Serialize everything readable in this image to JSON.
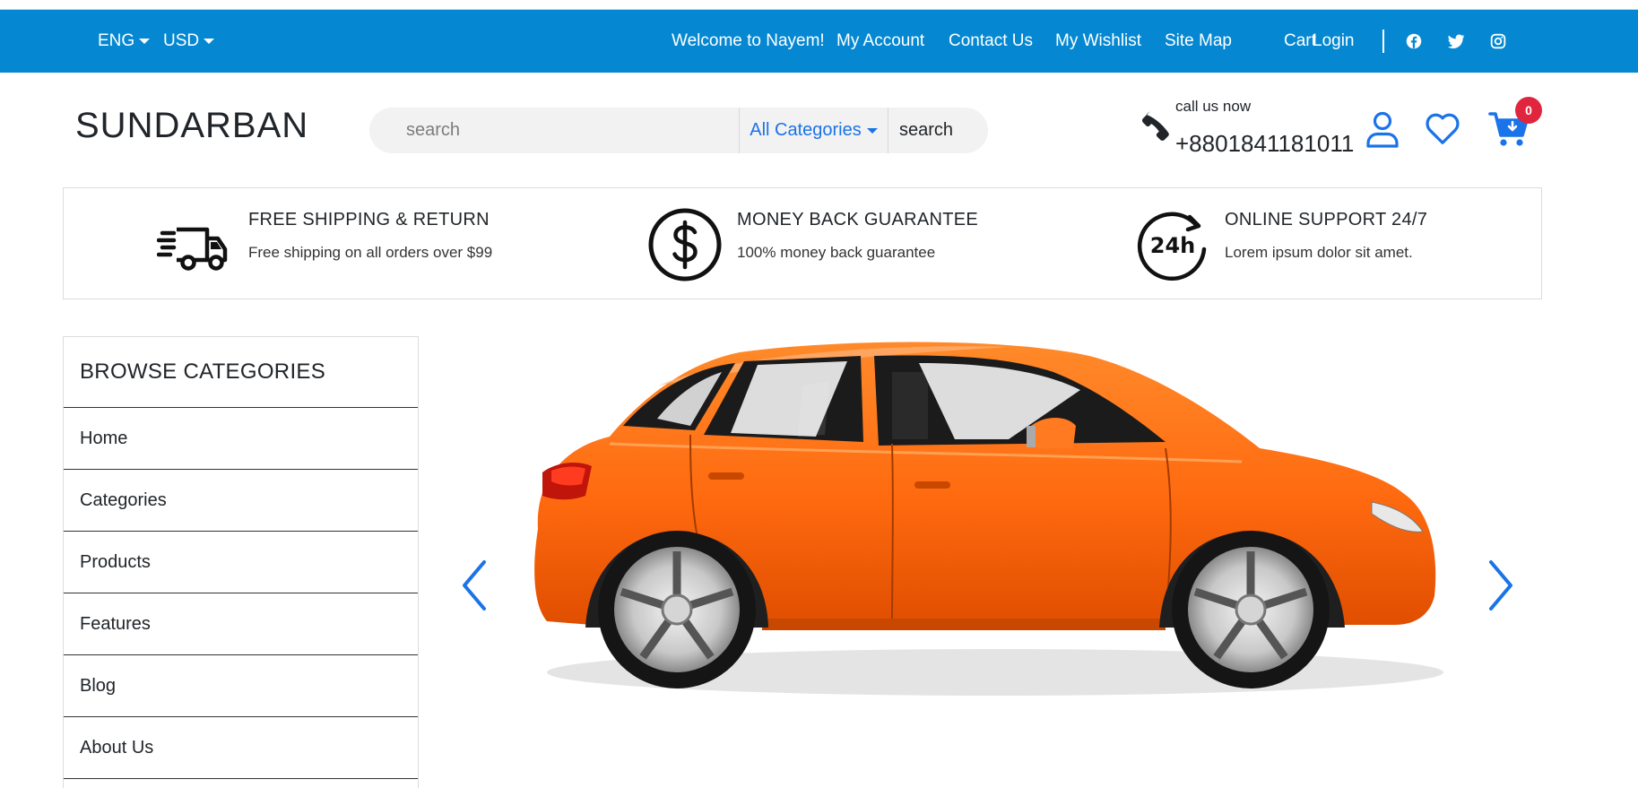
{
  "topbar": {
    "language": "ENG",
    "currency": "USD",
    "welcome": "Welcome to Nayem!",
    "links": [
      "My Account",
      "Contact Us",
      "My Wishlist",
      "Site Map",
      "Cart",
      "Login"
    ],
    "social_icons": [
      "facebook-icon",
      "twitter-icon",
      "instagram-icon"
    ],
    "background": "#0588d1"
  },
  "header": {
    "logo": "SUNDARBAN",
    "search_placeholder": "search",
    "category_select": "All Categories",
    "search_button": "search",
    "call_label": "call us now",
    "phone": "+8801841181011",
    "cart_count": "0",
    "accent": "#1a73e8",
    "badge_color": "#e0263e"
  },
  "features": [
    {
      "icon": "delivery-truck-icon",
      "title": "FREE SHIPPING & RETURN",
      "desc": "Free shipping on all orders over $99"
    },
    {
      "icon": "dollar-icon",
      "title": "MONEY BACK GUARANTEE",
      "desc": "100% money back guarantee"
    },
    {
      "icon": "24h-icon",
      "title": "ONLINE SUPPORT 24/7",
      "desc": "Lorem ipsum dolor sit amet."
    }
  ],
  "categories": {
    "title": "BROWSE CATEGORIES",
    "items": [
      "Home",
      "Categories",
      "Products",
      "Features",
      "Blog",
      "About Us"
    ]
  },
  "slider": {
    "image": "orange-hatchback-car",
    "car_color": "#ff6a10"
  }
}
